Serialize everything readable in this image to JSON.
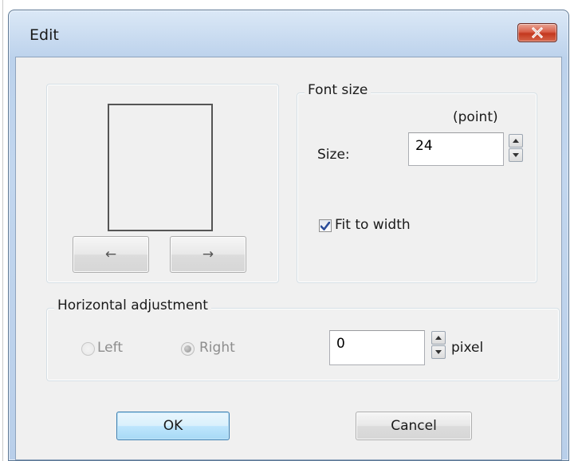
{
  "window": {
    "title": "Edit",
    "close_icon": "close-x-icon"
  },
  "preview": {
    "prev_label": "←",
    "next_label": "→"
  },
  "font_size": {
    "legend": "Font size",
    "unit": "(point)",
    "size_label": "Size:",
    "size_value": "24",
    "fit_to_width_label": "Fit to width",
    "fit_to_width_checked": true
  },
  "horizontal_adjustment": {
    "legend": "Horizontal adjustment",
    "left_label": "Left",
    "right_label": "Right",
    "selected": "Right",
    "offset_value": "0",
    "unit": "pixel"
  },
  "buttons": {
    "ok_label": "OK",
    "cancel_label": "Cancel"
  },
  "colors": {
    "title_bar": "#bcd2ec",
    "client_bg": "#f0f0f0",
    "close_button": "#c3381e",
    "default_button": "#3c7fb1"
  }
}
